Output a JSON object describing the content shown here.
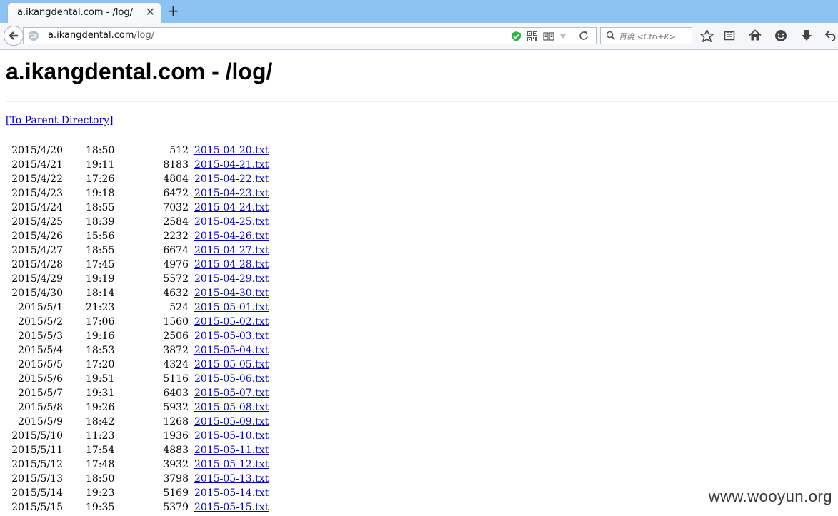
{
  "browser": {
    "tab_title": "a.ikangdental.com - /log/",
    "tab_close_glyph": "✕",
    "new_tab_glyph": "+",
    "url_host": "a.ikangdental.com",
    "url_path": "/log/",
    "search_placeholder": "百度 <Ctrl+K>",
    "icons": [
      "back-arrow-icon",
      "site-identity-icon",
      "shield-check-icon",
      "qr-code-icon",
      "reader-view-icon",
      "dropdown-arrow-icon",
      "reload-icon",
      "search-icon",
      "bookmark-star-icon",
      "bookmarks-list-icon",
      "home-icon",
      "smiley-icon",
      "download-icon",
      "undo-icon"
    ],
    "shield_color": "#2fb24c"
  },
  "page": {
    "title": "a.ikangdental.com - /log/",
    "parent_link": "[To Parent Directory]",
    "files": [
      {
        "date": "2015/4/20",
        "time": "18:50",
        "size": "512",
        "name": "2015-04-20.txt"
      },
      {
        "date": "2015/4/21",
        "time": "19:11",
        "size": "8183",
        "name": "2015-04-21.txt"
      },
      {
        "date": "2015/4/22",
        "time": "17:26",
        "size": "4804",
        "name": "2015-04-22.txt"
      },
      {
        "date": "2015/4/23",
        "time": "19:18",
        "size": "6472",
        "name": "2015-04-23.txt"
      },
      {
        "date": "2015/4/24",
        "time": "18:55",
        "size": "7032",
        "name": "2015-04-24.txt"
      },
      {
        "date": "2015/4/25",
        "time": "18:39",
        "size": "2584",
        "name": "2015-04-25.txt"
      },
      {
        "date": "2015/4/26",
        "time": "15:56",
        "size": "2232",
        "name": "2015-04-26.txt"
      },
      {
        "date": "2015/4/27",
        "time": "18:55",
        "size": "6674",
        "name": "2015-04-27.txt"
      },
      {
        "date": "2015/4/28",
        "time": "17:45",
        "size": "4976",
        "name": "2015-04-28.txt"
      },
      {
        "date": "2015/4/29",
        "time": "19:19",
        "size": "5572",
        "name": "2015-04-29.txt"
      },
      {
        "date": "2015/4/30",
        "time": "18:14",
        "size": "4632",
        "name": "2015-04-30.txt"
      },
      {
        "date": "2015/5/1",
        "time": "21:23",
        "size": "524",
        "name": "2015-05-01.txt"
      },
      {
        "date": "2015/5/2",
        "time": "17:06",
        "size": "1560",
        "name": "2015-05-02.txt"
      },
      {
        "date": "2015/5/3",
        "time": "19:16",
        "size": "2506",
        "name": "2015-05-03.txt"
      },
      {
        "date": "2015/5/4",
        "time": "18:53",
        "size": "3872",
        "name": "2015-05-04.txt"
      },
      {
        "date": "2015/5/5",
        "time": "17:20",
        "size": "4324",
        "name": "2015-05-05.txt"
      },
      {
        "date": "2015/5/6",
        "time": "19:51",
        "size": "5116",
        "name": "2015-05-06.txt"
      },
      {
        "date": "2015/5/7",
        "time": "19:31",
        "size": "6403",
        "name": "2015-05-07.txt"
      },
      {
        "date": "2015/5/8",
        "time": "19:26",
        "size": "5932",
        "name": "2015-05-08.txt"
      },
      {
        "date": "2015/5/9",
        "time": "18:42",
        "size": "1268",
        "name": "2015-05-09.txt"
      },
      {
        "date": "2015/5/10",
        "time": "11:23",
        "size": "1936",
        "name": "2015-05-10.txt"
      },
      {
        "date": "2015/5/11",
        "time": "17:54",
        "size": "4883",
        "name": "2015-05-11.txt"
      },
      {
        "date": "2015/5/12",
        "time": "17:48",
        "size": "3932",
        "name": "2015-05-12.txt"
      },
      {
        "date": "2015/5/13",
        "time": "18:50",
        "size": "3798",
        "name": "2015-05-13.txt"
      },
      {
        "date": "2015/5/14",
        "time": "19:23",
        "size": "5169",
        "name": "2015-05-14.txt"
      },
      {
        "date": "2015/5/15",
        "time": "19:35",
        "size": "5379",
        "name": "2015-05-15.txt"
      }
    ]
  },
  "watermark": "www.wooyun.org",
  "colors": {
    "tabstrip": "#8cc3f3",
    "link": "#0000cc"
  }
}
